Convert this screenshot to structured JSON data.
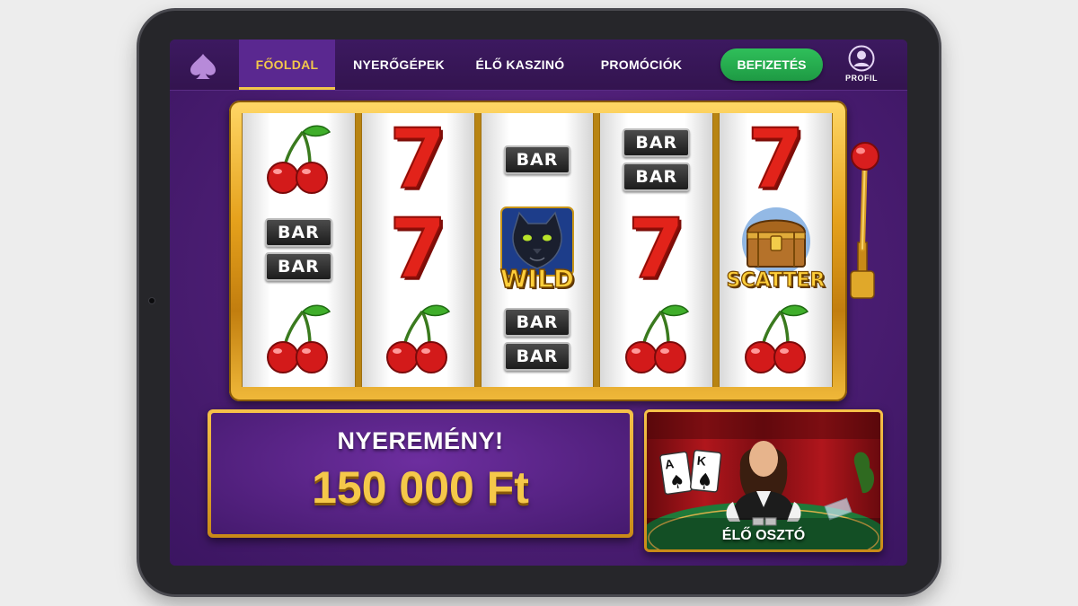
{
  "nav": {
    "logo_icon": "spade-icon",
    "items": [
      {
        "label": "FŐOLDAL",
        "active": true
      },
      {
        "label": "NYERŐGÉPEK",
        "active": false
      },
      {
        "label": "ÉLŐ KASZINÓ",
        "active": false
      },
      {
        "label": "PROMÓCIÓK",
        "active": false
      }
    ],
    "deposit_label": "BEFIZETÉS",
    "profile_label": "PROFIL"
  },
  "slot": {
    "reels": [
      [
        "cherry",
        "bar-double",
        "cherry"
      ],
      [
        "seven",
        "seven",
        "cherry"
      ],
      [
        "bar-single",
        "wild",
        "bar-double"
      ],
      [
        "bar-double",
        "seven",
        "cherry"
      ],
      [
        "seven",
        "scatter",
        "cherry"
      ]
    ],
    "seven_text": "7",
    "bar_text": "BAR",
    "wild_text": "WILD",
    "scatter_text": "SCATTER"
  },
  "win": {
    "title": "NYEREMÉNY!",
    "amount": "150 000 Ft"
  },
  "live": {
    "label": "ÉLŐ OSZTÓ",
    "card_a": "A",
    "card_k": "K"
  },
  "colors": {
    "accent_gold": "#f2c74a",
    "deposit_green": "#2fbf5a",
    "purple_bg": "#4e1f76",
    "seven_red": "#e2231a"
  }
}
